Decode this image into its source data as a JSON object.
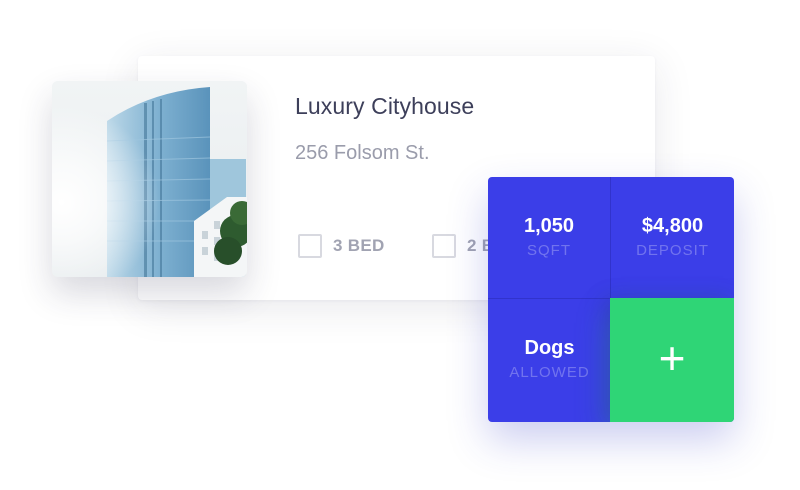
{
  "listing": {
    "title": "Luxury Cityhouse",
    "address": "256 Folsom St.",
    "photo_icon": "building-photo",
    "features": [
      {
        "label": "3 BED",
        "icon": "checkbox-icon"
      },
      {
        "label": "2 B",
        "icon": "checkbox-icon"
      }
    ]
  },
  "stats": {
    "sqft": {
      "value": "1,050",
      "label": "SQFT"
    },
    "deposit": {
      "value": "$4,800",
      "label": "DEPOSIT"
    },
    "pets": {
      "value": "Dogs",
      "label": "ALLOWED"
    },
    "add_button": {
      "icon": "plus-icon",
      "glyph": "+"
    }
  },
  "colors": {
    "stats_blue": "#3b3ee8",
    "add_green": "#2fd576",
    "title_text": "#3d3f5a",
    "muted_text": "#9a9cab"
  }
}
